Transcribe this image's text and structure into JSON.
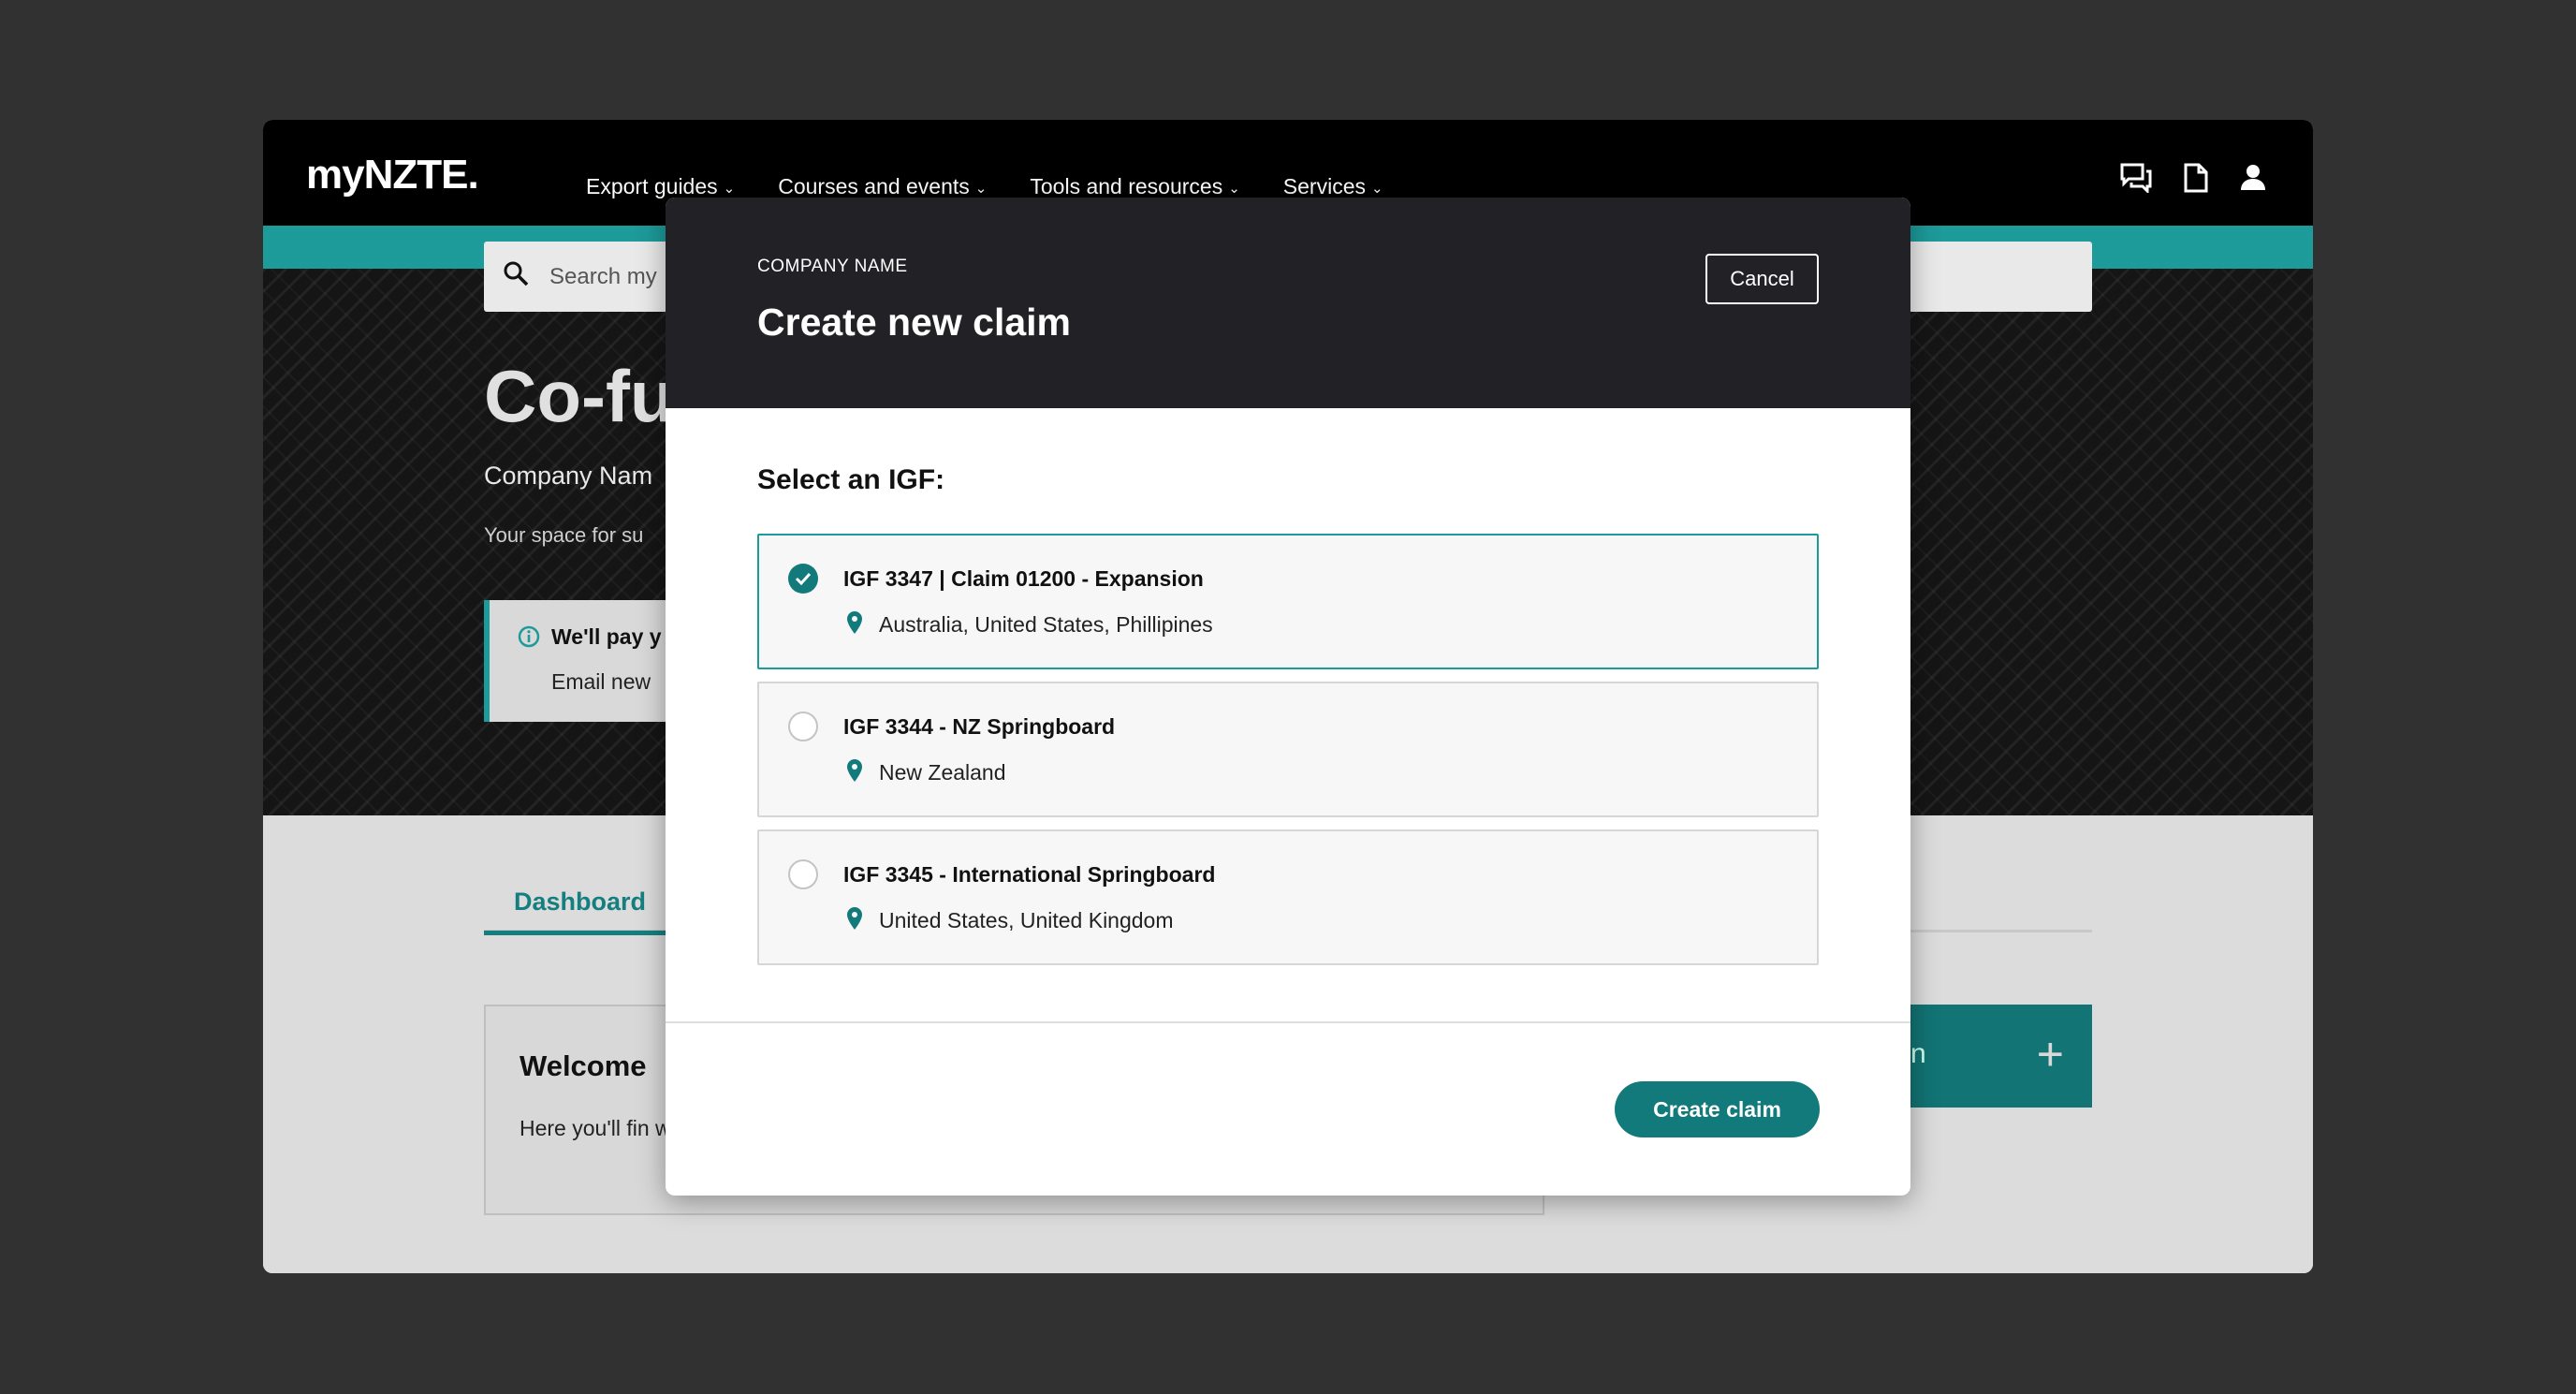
{
  "app": {
    "logo": "myNZTE.",
    "nav": [
      {
        "label": "Export guides"
      },
      {
        "label": "Courses and events"
      },
      {
        "label": "Tools and resources"
      },
      {
        "label": "Services"
      }
    ],
    "nav_icons": [
      "chat-icon",
      "document-icon",
      "user-icon"
    ]
  },
  "background_page": {
    "search_placeholder": "Search my",
    "title": "Co-fu",
    "company_name": "Company Nam",
    "description": "Your space for su",
    "info_title": "We'll pay y",
    "info_text": "Email new",
    "tab_dashboard": "Dashboard",
    "welcome_title": "Welcome",
    "welcome_text": "Here you'll fin with the guide",
    "action_fragment": "n",
    "action_plus": "+"
  },
  "modal": {
    "kicker": "COMPANY NAME",
    "title": "Create new claim",
    "cancel_label": "Cancel",
    "select_label": "Select an IGF:",
    "options": [
      {
        "title": "IGF 3347 | Claim 01200 - Expansion",
        "location": "Australia, United States, Phillipines",
        "selected": true
      },
      {
        "title": "IGF 3344 - NZ Springboard",
        "location": "New Zealand",
        "selected": false
      },
      {
        "title": "IGF 3345 - International Springboard",
        "location": "United States, United Kingdom",
        "selected": false
      }
    ],
    "create_label": "Create claim"
  },
  "colors": {
    "accent": "#1d9a9a",
    "primary_button": "#127a7a",
    "modal_header": "#222226",
    "backdrop": "#313131"
  }
}
